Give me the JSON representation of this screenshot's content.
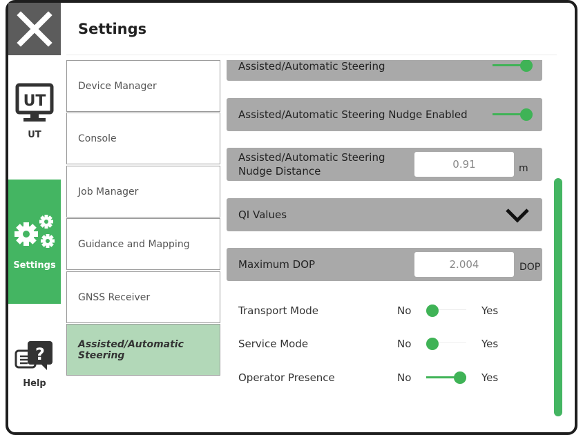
{
  "header": {
    "title": "Settings"
  },
  "rail": {
    "items": [
      {
        "label": "UT",
        "icon": "ut-monitor-icon"
      },
      {
        "label": "Settings",
        "icon": "gears-icon",
        "active": true
      },
      {
        "label": "Help",
        "icon": "help-chat-icon"
      }
    ],
    "ut_icon_text": "UT"
  },
  "submenu": {
    "items": [
      {
        "label": "Device Manager"
      },
      {
        "label": "Console"
      },
      {
        "label": "Job Manager"
      },
      {
        "label": "Guidance and Mapping"
      },
      {
        "label": "GNSS Receiver"
      },
      {
        "label": "Assisted/Automatic Steering",
        "active": true
      }
    ]
  },
  "content": {
    "partial_row_label": "Assisted/Automatic Steering",
    "nudge_enabled": {
      "label": "Assisted/Automatic Steering Nudge Enabled",
      "on": true
    },
    "nudge_distance": {
      "label_line1": "Assisted/Automatic Steering",
      "label_line2": "Nudge Distance",
      "value": "0.91",
      "unit": "m"
    },
    "qi_values": {
      "label": "QI Values"
    },
    "max_dop": {
      "label": "Maximum DOP",
      "value": "2.004",
      "unit": "DOP"
    },
    "toggles": [
      {
        "label": "Transport Mode",
        "no": "No",
        "yes": "Yes",
        "value": "No"
      },
      {
        "label": "Service Mode",
        "no": "No",
        "yes": "Yes",
        "value": "No"
      },
      {
        "label": "Operator Presence",
        "no": "No",
        "yes": "Yes",
        "value": "Yes"
      }
    ]
  },
  "colors": {
    "accent_green": "#44b562",
    "knob_green": "#3fb356",
    "row_gray": "#a9a9a9",
    "active_sub_bg": "#b2d8b8",
    "close_bg": "#5c5c5c"
  }
}
